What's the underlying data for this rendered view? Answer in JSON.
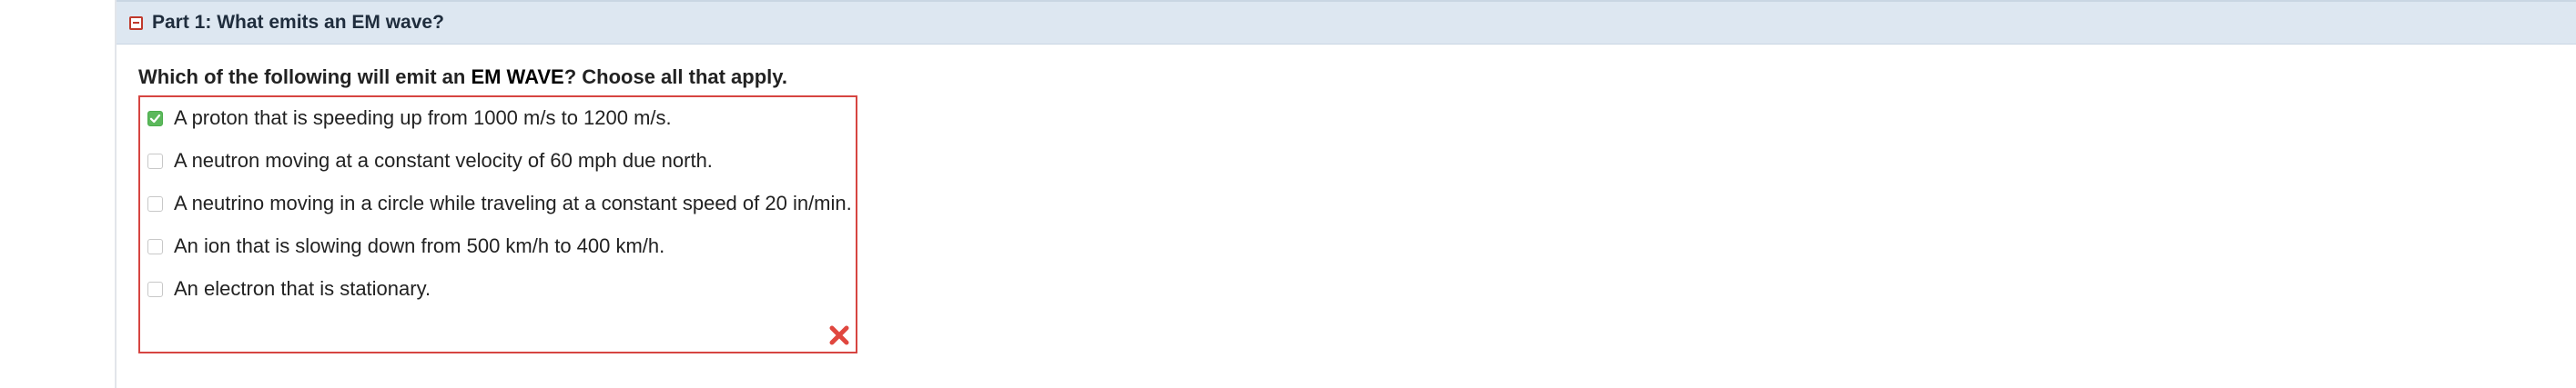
{
  "part": {
    "title": "Part 1: What emits an EM wave?"
  },
  "question": {
    "prefix": "Which of the following will emit an ",
    "emphasis": "EM WAVE",
    "suffix": "? Choose all that apply."
  },
  "choices": [
    {
      "label": "A proton that is speeding up from 1000 m/s to 1200 m/s.",
      "checked": true
    },
    {
      "label": "A neutron moving at a constant velocity of 60 mph due north.",
      "checked": false
    },
    {
      "label": "A neutrino moving in a circle while traveling at a constant speed of 20 in/min.",
      "checked": false
    },
    {
      "label": "An ion that is slowing down from 500 km/h to 400 km/h.",
      "checked": false
    },
    {
      "label": "An electron that is stationary.",
      "checked": false
    }
  ],
  "colors": {
    "header_bg": "#dde7f1",
    "error_red": "#d64541",
    "check_green": "#5cb85c"
  },
  "icons": {
    "collapse": "minus-square-icon",
    "checked": "checkmark-icon",
    "result": "incorrect-x-icon"
  }
}
